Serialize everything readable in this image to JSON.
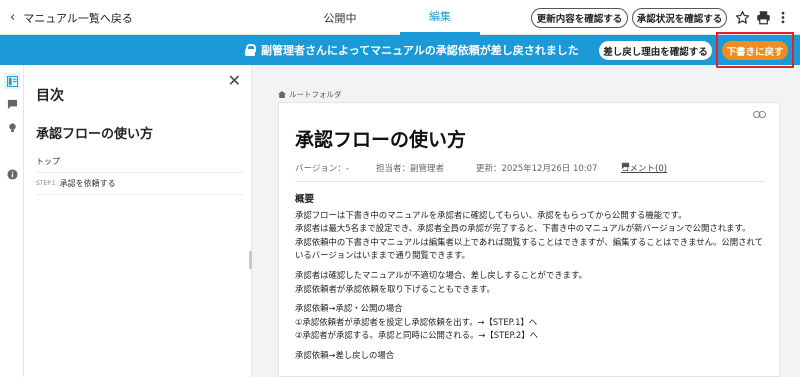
{
  "header": {
    "back_label": "マニュアル一覧へ戻る",
    "tabs": [
      {
        "label": "公開中",
        "active": false
      },
      {
        "label": "編集",
        "active": true
      }
    ],
    "check_changes_label": "更新内容を確認する",
    "check_approval_label": "承認状況を確認する",
    "icons": [
      "star-icon",
      "print-icon",
      "more-icon"
    ]
  },
  "banner": {
    "message": "副管理者さんによってマニュアルの承認依頼が差し戻されました",
    "reason_button": "差し戻し理由を確認する",
    "draft_button": "下書きに戻す",
    "color": "#1b9ad7",
    "draft_color": "#f28c1e"
  },
  "toc": {
    "heading": "目次",
    "doc_title": "承認フローの使い方",
    "items": [
      {
        "step": "",
        "label": "トップ"
      },
      {
        "step": "STEP.1",
        "label": "承認を依頼する"
      }
    ]
  },
  "breadcrumb": "ルートフォルダ",
  "document": {
    "title": "承認フローの使い方",
    "version": "バージョン：-",
    "owner": "担当者：副管理者",
    "updated": "更新：2025年12月26日 10:07",
    "comment": "コメント(0)",
    "section_heading": "概要",
    "paragraphs": [
      "承認フローは下書き中のマニュアルを承認者に確認してもらい、承認をもらってから公開する機能です。",
      "承認者は最大5名まで設定でき、承認者全員の承認が完了すると、下書き中のマニュアルが新バージョンで公開されます。",
      "承認依頼中の下書き中マニュアルは編集者以上であれば閲覧することはできますが、編集することはできません。公開されているバージョンはいままで通り閲覧できます。",
      "",
      "承認者は確認したマニュアルが不適切な場合、差し戻しすることができます。",
      "承認依頼者が承認依頼を取り下げることもできます。",
      "",
      "承認依頼→承認・公開の場合",
      "①承認依頼者が承認者を設定し承認依頼を出す。→【STEP.1】へ",
      "②承認者が承認する。承認と同時に公開される。→【STEP.2】へ",
      "",
      "承認依頼→差し戻しの場合"
    ]
  }
}
